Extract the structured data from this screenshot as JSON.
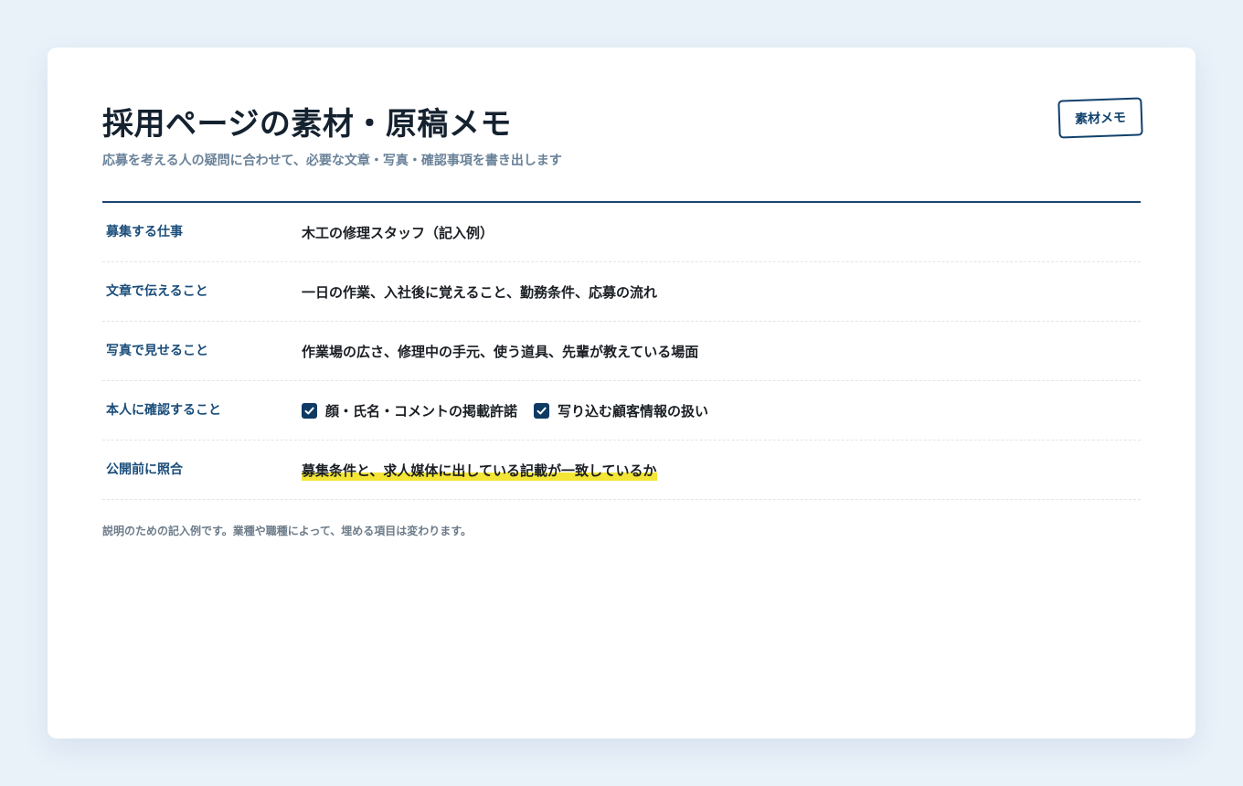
{
  "header": {
    "title": "採用ページの素材・原稿メモ",
    "subtitle": "応募を考える人の疑問に合わせて、必要な文章・写真・確認事項を書き出します",
    "badge": "素材メモ"
  },
  "rows": [
    {
      "label": "募集する仕事",
      "value": "木工の修理スタッフ（記入例）"
    },
    {
      "label": "文章で伝えること",
      "value": "一日の作業、入社後に覚えること、勤務条件、応募の流れ"
    },
    {
      "label": "写真で見せること",
      "value": "作業場の広さ、修理中の手元、使う道具、先輩が教えている場面"
    },
    {
      "label": "本人に確認すること",
      "checks": [
        {
          "label": "顔・氏名・コメントの掲載許諾",
          "checked": true
        },
        {
          "label": "写り込む顧客情報の扱い",
          "checked": true
        }
      ]
    },
    {
      "label": "公開前に照合",
      "value": "募集条件と、求人媒体に出している記載が一致しているか"
    }
  ],
  "footnote": "説明のための記入例です。業種や職種によって、埋める項目は変わります。",
  "colors": {
    "accent": "#11416c",
    "highlight": "#f4e536",
    "background": "#e9f1f9"
  }
}
